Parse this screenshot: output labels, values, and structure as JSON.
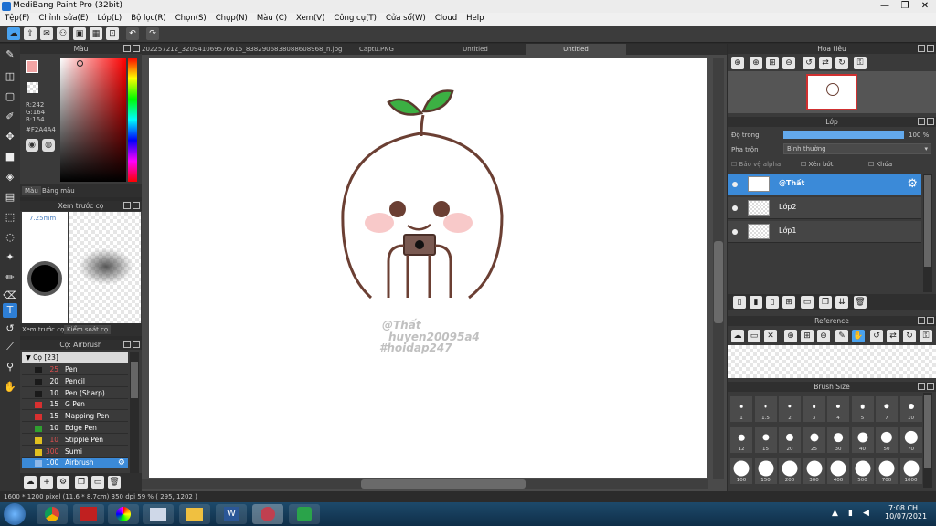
{
  "window": {
    "title": "MediBang Paint Pro (32bit)",
    "minimize": "—",
    "maximize": "❐",
    "close": "✕"
  },
  "menu": [
    "Tệp(F)",
    "Chỉnh sửa(E)",
    "Lớp(L)",
    "Bộ lọc(R)",
    "Chọn(S)",
    "Chụp(N)",
    "Màu (C)",
    "Xem(V)",
    "Công cụ(T)",
    "Cửa sổ(W)",
    "Cloud",
    "Help"
  ],
  "color_panel": {
    "title": "Màu",
    "r": "R:242",
    "g": "G:164",
    "b": "B:164",
    "hex": "#F2A4A4",
    "tab_color": "Màu",
    "tab_palette": "Bảng màu",
    "primary": "#F2A4A4"
  },
  "brush_preview": {
    "title": "Xem trước cọ",
    "size": "7.25mm",
    "tab_preview": "Xem trước cọ",
    "tab_control": "Kiểm soát cọ"
  },
  "brush_panel": {
    "title": "Cọ: Airbrush",
    "group": "Cọ [23]",
    "rows": [
      {
        "size": "25",
        "name": "Pen",
        "color": "#1a1a1a",
        "size_color": "#e05050"
      },
      {
        "size": "20",
        "name": "Pencil",
        "color": "#1a1a1a",
        "size_color": "#ffffff"
      },
      {
        "size": "10",
        "name": "Pen (Sharp)",
        "color": "#1a1a1a",
        "size_color": "#ffffff"
      },
      {
        "size": "15",
        "name": "G Pen",
        "color": "#d83030",
        "size_color": "#ffffff"
      },
      {
        "size": "15",
        "name": "Mapping Pen",
        "color": "#d83030",
        "size_color": "#ffffff"
      },
      {
        "size": "10",
        "name": "Edge Pen",
        "color": "#30a030",
        "size_color": "#ffffff"
      },
      {
        "size": "10",
        "name": "Stipple Pen",
        "color": "#e0c020",
        "size_color": "#e05050"
      },
      {
        "size": "300",
        "name": "Sumi",
        "color": "#e0c020",
        "size_color": "#e05050"
      },
      {
        "size": "100",
        "name": "Airbrush",
        "color": "#8fb8e8",
        "size_color": "#ffffff"
      }
    ]
  },
  "tabs": [
    "202257212_320941069576615_8382906838088608968_n.jpg",
    "Captu.PNG",
    "Untitled",
    "Untitled"
  ],
  "canvas": {
    "watermark1": "@Thất",
    "watermark2": "huyen20095a4",
    "watermark3": "#hoidap247"
  },
  "status": {
    "text": "1600 * 1200 pixel  (11.6 * 8.7cm)  350 dpi  59 %  ( 295, 1202 )"
  },
  "navigator": {
    "title": "Hoa tiêu"
  },
  "layers": {
    "title": "Lớp",
    "opacity_label": "Độ trong",
    "opacity_value": "100 %",
    "opacity": 1.0,
    "blend_label": "Pha trộn",
    "blend_value": "Bình thường",
    "protect_alpha": "Bảo vệ alpha",
    "clip": "Xén bớt",
    "lock": "Khóa",
    "items": [
      {
        "name": "@Thất",
        "selected": true
      },
      {
        "name": "Lớp2",
        "selected": false
      },
      {
        "name": "Lớp1",
        "selected": false
      }
    ]
  },
  "reference": {
    "title": "Reference"
  },
  "brush_size": {
    "title": "Brush Size",
    "sizes": [
      "1",
      "1.5",
      "2",
      "3",
      "4",
      "5",
      "7",
      "10",
      "12",
      "15",
      "20",
      "25",
      "30",
      "40",
      "50",
      "70",
      "100",
      "150",
      "200",
      "300",
      "400",
      "500",
      "700",
      "1000"
    ]
  },
  "clock": {
    "time": "7:08 CH",
    "date": "10/07/2021"
  }
}
